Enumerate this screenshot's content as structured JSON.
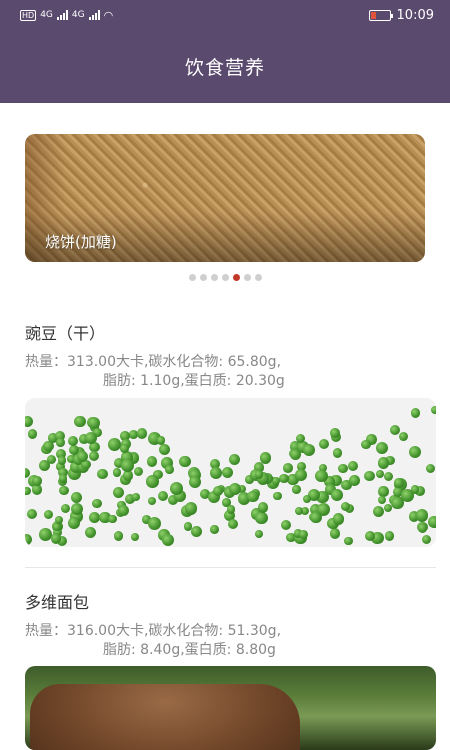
{
  "status_bar": {
    "left_hd": "HD",
    "left_net1": "4G",
    "left_net2": "4G",
    "time": "10:09"
  },
  "header": {
    "title": "饮食营养"
  },
  "banner": {
    "caption": "烧饼(加糖)",
    "dot_count": 7,
    "active_index": 4
  },
  "foods": [
    {
      "name": "豌豆（干）",
      "nutrition_line1": "热量：313.00大卡,碳水化合物: 65.80g,",
      "nutrition_line2": "脂肪: 1.10g,蛋白质: 20.30g"
    },
    {
      "name": "多维面包",
      "nutrition_line1": "热量：316.00大卡,碳水化合物: 51.30g,",
      "nutrition_line2": "脂肪: 8.40g,蛋白质: 8.80g"
    }
  ],
  "colors": {
    "header_bg": "#5a4a6e",
    "active_dot": "#c0392b",
    "battery_low": "#e0533d"
  }
}
